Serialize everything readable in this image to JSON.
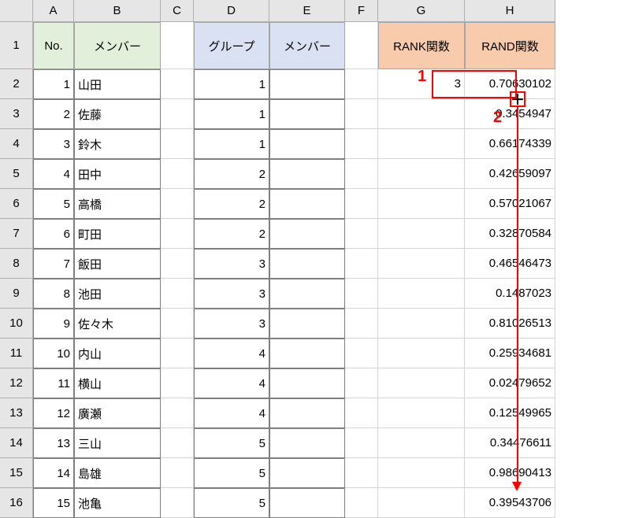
{
  "columns": [
    "A",
    "B",
    "C",
    "D",
    "E",
    "F",
    "G",
    "H"
  ],
  "row_numbers": [
    1,
    2,
    3,
    4,
    5,
    6,
    7,
    8,
    9,
    10,
    11,
    12,
    13,
    14,
    15,
    16
  ],
  "headers": {
    "A": "No.",
    "B": "メンバー",
    "D": "グループ",
    "E": "メンバー",
    "G": "RANK関数",
    "H": "RAND関数"
  },
  "rows": [
    {
      "no": "1",
      "member": "山田",
      "group": "1",
      "rank": "3",
      "rand": "0.70630102"
    },
    {
      "no": "2",
      "member": "佐藤",
      "group": "1",
      "rank": "",
      "rand": "0.3454947"
    },
    {
      "no": "3",
      "member": "鈴木",
      "group": "1",
      "rank": "",
      "rand": "0.66174339"
    },
    {
      "no": "4",
      "member": "田中",
      "group": "2",
      "rank": "",
      "rand": "0.42659097"
    },
    {
      "no": "5",
      "member": "高橋",
      "group": "2",
      "rank": "",
      "rand": "0.57021067"
    },
    {
      "no": "6",
      "member": "町田",
      "group": "2",
      "rank": "",
      "rand": "0.32870584"
    },
    {
      "no": "7",
      "member": "飯田",
      "group": "3",
      "rank": "",
      "rand": "0.46546473"
    },
    {
      "no": "8",
      "member": "池田",
      "group": "3",
      "rank": "",
      "rand": "0.1487023"
    },
    {
      "no": "9",
      "member": "佐々木",
      "group": "3",
      "rank": "",
      "rand": "0.81026513"
    },
    {
      "no": "10",
      "member": "内山",
      "group": "4",
      "rank": "",
      "rand": "0.25934681"
    },
    {
      "no": "11",
      "member": "横山",
      "group": "4",
      "rank": "",
      "rand": "0.02479652"
    },
    {
      "no": "12",
      "member": "廣瀬",
      "group": "4",
      "rank": "",
      "rand": "0.12549965"
    },
    {
      "no": "13",
      "member": "三山",
      "group": "5",
      "rank": "",
      "rand": "0.34476611"
    },
    {
      "no": "14",
      "member": "島雄",
      "group": "5",
      "rank": "",
      "rand": "0.98690413"
    },
    {
      "no": "15",
      "member": "池亀",
      "group": "5",
      "rank": "",
      "rand": "0.39543706"
    }
  ],
  "annotations": {
    "label1": "1",
    "label2": "2",
    "fill_handle_glyph": "＋"
  },
  "chart_data": {
    "type": "table",
    "title": "",
    "columns": [
      "No.",
      "メンバー",
      "グループ",
      "メンバー",
      "RANK関数",
      "RAND関数"
    ],
    "data": [
      [
        1,
        "山田",
        1,
        "",
        3,
        0.70630102
      ],
      [
        2,
        "佐藤",
        1,
        "",
        "",
        0.3454947
      ],
      [
        3,
        "鈴木",
        1,
        "",
        "",
        0.66174339
      ],
      [
        4,
        "田中",
        2,
        "",
        "",
        0.42659097
      ],
      [
        5,
        "高橋",
        2,
        "",
        "",
        0.57021067
      ],
      [
        6,
        "町田",
        2,
        "",
        "",
        0.32870584
      ],
      [
        7,
        "飯田",
        3,
        "",
        "",
        0.46546473
      ],
      [
        8,
        "池田",
        3,
        "",
        "",
        0.1487023
      ],
      [
        9,
        "佐々木",
        3,
        "",
        "",
        0.81026513
      ],
      [
        10,
        "内山",
        4,
        "",
        "",
        0.25934681
      ],
      [
        11,
        "横山",
        4,
        "",
        "",
        0.02479652
      ],
      [
        12,
        "廣瀬",
        4,
        "",
        "",
        0.12549965
      ],
      [
        13,
        "三山",
        5,
        "",
        "",
        0.34476611
      ],
      [
        14,
        "島雄",
        5,
        "",
        "",
        0.98690413
      ],
      [
        15,
        "池亀",
        5,
        "",
        "",
        0.39543706
      ]
    ]
  }
}
